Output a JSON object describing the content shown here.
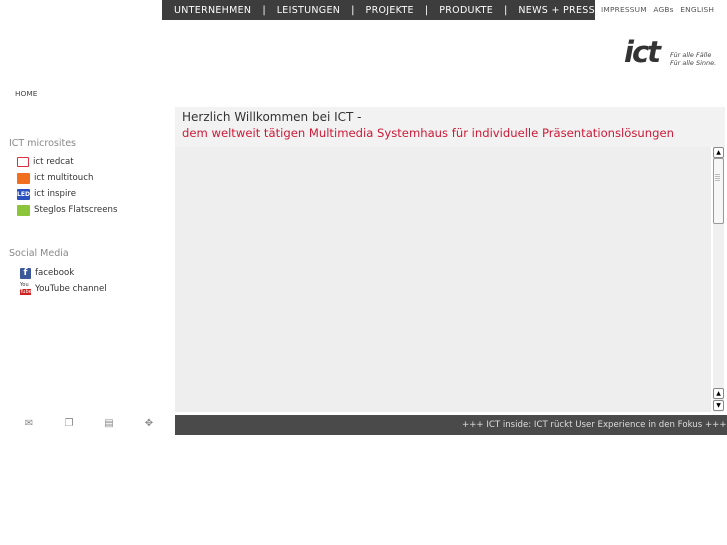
{
  "nav": {
    "items": [
      "UNTERNEHMEN",
      "LEISTUNGEN",
      "PROJEKTE",
      "PRODUKTE",
      "NEWS + PRESSE"
    ],
    "separator": "|"
  },
  "utility": {
    "items": [
      "IMPRESSUM",
      "AGBs",
      "ENGLISH"
    ]
  },
  "logo": {
    "mark": "ict",
    "tagline1": "Für alle Fälle",
    "tagline2": "Für alle Sinne."
  },
  "breadcrumb": {
    "home": "HOME"
  },
  "microsites": {
    "title": "ICT microsites",
    "items": [
      {
        "label": "ict redcat",
        "icon": "redcat-icon"
      },
      {
        "label": "ict multitouch",
        "icon": "multitouch-icon"
      },
      {
        "label": "ict inspire",
        "icon": "inspire-icon",
        "icon_text": "LED"
      },
      {
        "label": "Steglos Flatscreens",
        "icon": "flatscreen-icon"
      }
    ]
  },
  "social": {
    "title": "Social Media",
    "items": [
      {
        "label": "facebook",
        "icon": "facebook-icon",
        "icon_text": "f"
      },
      {
        "label": "YouTube channel",
        "icon": "youtube-icon",
        "icon_text_top": "You",
        "icon_text_bottom": "Tube"
      }
    ]
  },
  "tools": [
    "mail-icon",
    "share-icon",
    "print-icon",
    "move-icon"
  ],
  "welcome": {
    "line1": "Herzlich Willkommen bei ICT -",
    "line2": "dem weltweit tätigen Multimedia Systemhaus für individuelle Präsentationslösungen"
  },
  "ticker": {
    "text": "+++    ICT inside: ICT rückt User Experience in den Fokus    +++"
  },
  "colors": {
    "nav_bg": "#3d3d3d",
    "accent_red": "#cc1a38",
    "ticker_bg": "#4a4a4a",
    "content_bg": "#eeeeee"
  }
}
